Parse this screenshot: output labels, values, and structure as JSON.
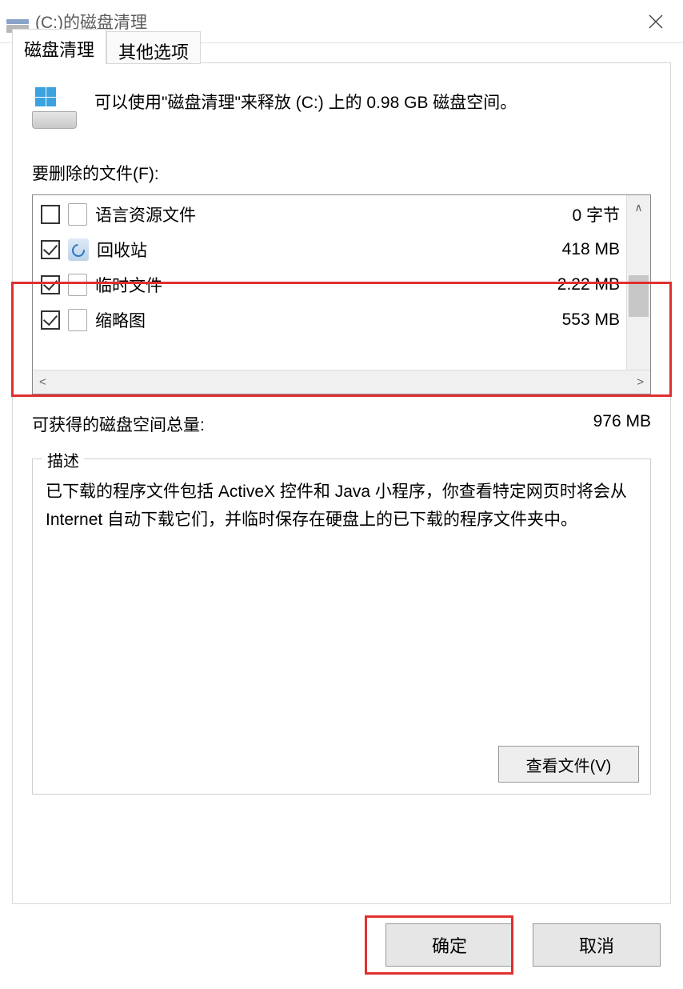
{
  "title": "(C:)的磁盘清理",
  "tabs": {
    "active": "磁盘清理",
    "inactive": "其他选项"
  },
  "intro": "可以使用\"磁盘清理\"来释放  (C:) 上的 0.98 GB 磁盘空间。",
  "files_label": "要删除的文件(F):",
  "files": [
    {
      "name": "语言资源文件",
      "size": "0 字节",
      "checked": false,
      "icon": "file"
    },
    {
      "name": "回收站",
      "size": "418 MB",
      "checked": true,
      "icon": "recycle"
    },
    {
      "name": "临时文件",
      "size": "2.22 MB",
      "checked": true,
      "icon": "file"
    },
    {
      "name": "缩略图",
      "size": "553 MB",
      "checked": true,
      "icon": "file"
    }
  ],
  "total_label": "可获得的磁盘空间总量:",
  "total_value": "976 MB",
  "desc_legend": "描述",
  "desc_text": "已下载的程序文件包括 ActiveX 控件和 Java 小程序，你查看特定网页时将会从 Internet 自动下载它们，并临时保存在硬盘上的已下载的程序文件夹中。",
  "view_files_btn": "查看文件(V)",
  "ok_btn": "确定",
  "cancel_btn": "取消"
}
